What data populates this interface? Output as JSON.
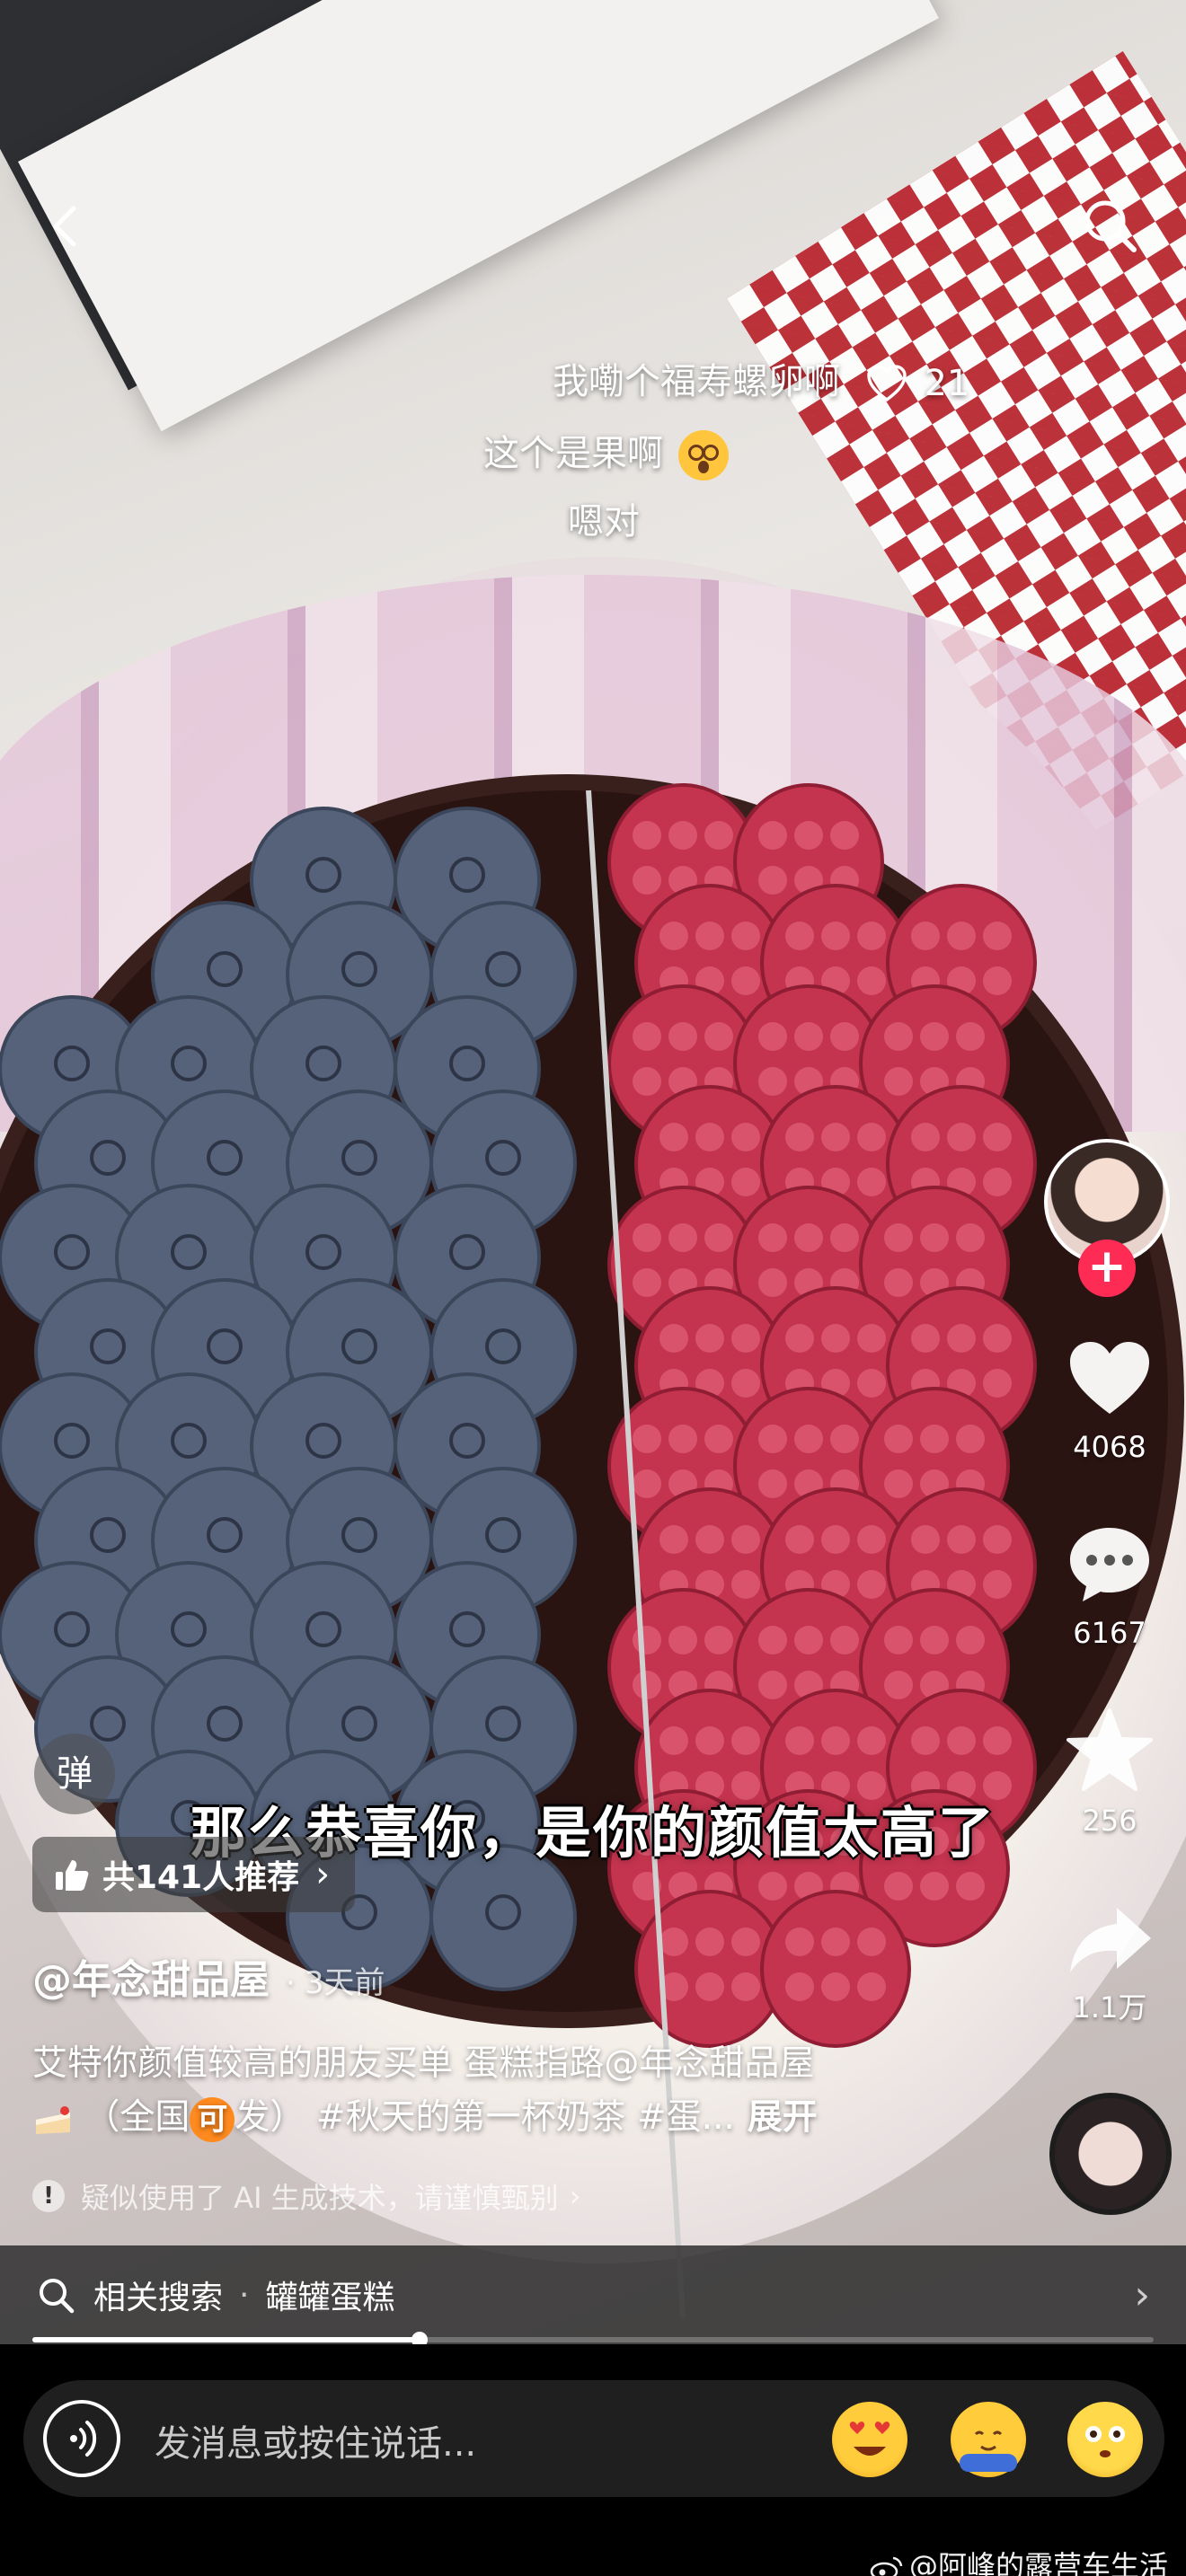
{
  "danmaku": [
    {
      "text": "我嘞个福寿螺卵啊",
      "likes": "21"
    },
    {
      "text": "这个是果啊"
    },
    {
      "text": "嗯对"
    }
  ],
  "subtitle": "那么恭喜你，是你的颜值太高了",
  "danmaku_toggle": "弹",
  "recommend": {
    "label": "共141人推荐"
  },
  "author": {
    "handle": "@年念甜品屋",
    "time": "3天前"
  },
  "caption": {
    "line1": "艾特你颜值较高的朋友买单 蛋糕指路@年念甜品屋",
    "line2_pre": "（全国",
    "badge": "可",
    "line2_post": "发） #秋天的第一杯奶茶 #蛋...",
    "expand": "展开"
  },
  "ai_notice": "疑似使用了 AI 生成技术，请谨慎甄别",
  "actions": {
    "like_count": "4068",
    "comment_count": "6167",
    "favorite_count": "256",
    "share_count": "1.1万"
  },
  "related_search": {
    "label": "相关搜索",
    "query": "罐罐蛋糕"
  },
  "progress": {
    "fraction": 0.345
  },
  "input": {
    "placeholder": "发消息或按住说话..."
  },
  "watermark": "@阿峰的露营车生活",
  "colors": {
    "accent": "#fe2c55",
    "badge": "#ff8a1f"
  },
  "icons": [
    "back-icon",
    "search-icon",
    "heart-icon",
    "comment-icon",
    "star-icon",
    "share-icon",
    "thumb-up-icon",
    "info-icon",
    "voice-icon"
  ]
}
